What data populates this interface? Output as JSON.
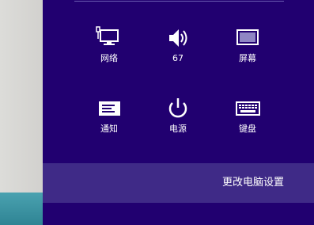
{
  "settings_pane": {
    "tiles": [
      {
        "label": "网络",
        "icon": "network-icon"
      },
      {
        "label": "67",
        "icon": "volume-icon"
      },
      {
        "label": "屏幕",
        "icon": "screen-icon"
      },
      {
        "label": "通知",
        "icon": "notifications-icon"
      },
      {
        "label": "电源",
        "icon": "power-icon"
      },
      {
        "label": "键盘",
        "icon": "keyboard-icon"
      }
    ],
    "change_pc_settings": "更改电脑设置"
  },
  "colors": {
    "pane_background": "#210070",
    "settings_bar": "#3f2a87",
    "desktop": "#d7d6d3",
    "taskbar": "#3a93a2"
  }
}
